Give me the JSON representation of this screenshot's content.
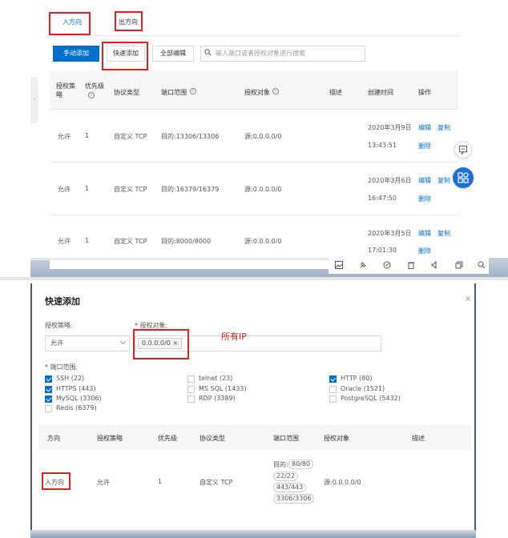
{
  "security_rules": {
    "tabs": [
      {
        "label": "入方向",
        "active": true
      },
      {
        "label": "出方向",
        "active": false
      }
    ],
    "toolbar": {
      "manual_add": "手动添加",
      "quick_add": "快速添加",
      "edit_all": "全部编辑",
      "search_placeholder": "输入端口或者授权对象进行搜索"
    },
    "columns": [
      "授权策略",
      "优先级",
      "协议类型",
      "端口范围",
      "授权对象",
      "描述",
      "创建时间",
      "操作"
    ],
    "rows": [
      {
        "policy": "允许",
        "priority": "1",
        "protocol": "自定义 TCP",
        "ports": "目的:13306/13306",
        "source": "源:0.0.0.0/0",
        "date": "2020年3月9日",
        "time": "13:43:51",
        "edit": "编辑",
        "copy": "复制",
        "delete": "删除"
      },
      {
        "policy": "允许",
        "priority": "1",
        "protocol": "自定义 TCP",
        "ports": "目的:16379/16379",
        "source": "源:0.0.0.0/0",
        "date": "2020年3月6日",
        "time": "16:47:50",
        "edit": "编辑",
        "copy": "复制",
        "delete": "删除"
      },
      {
        "policy": "允许",
        "priority": "1",
        "protocol": "自定义 TCP",
        "ports": "目的:8000/8000",
        "source": "源:0.0.0.0/0",
        "date": "2020年3月5日",
        "time": "17:01:30",
        "edit": "编辑",
        "copy": "复制",
        "delete": "删除"
      }
    ]
  },
  "quick_add_dialog": {
    "title": "快速添加",
    "close": "×",
    "policy_label": "授权策略:",
    "policy_value": "允许",
    "target_label": "授权对象:",
    "target_tag": "0.0.0.0/0",
    "tag_close": "×",
    "annotation": "所有IP",
    "port_label": "端口范围:",
    "ports": [
      {
        "label": "SSH (22)",
        "checked": true
      },
      {
        "label": "HTTPS (443)",
        "checked": true
      },
      {
        "label": "MySQL (3306)",
        "checked": true
      },
      {
        "label": "Redis (6379)",
        "checked": false
      },
      {
        "label": "telnet (23)",
        "checked": false
      },
      {
        "label": "MS SQL (1433)",
        "checked": false
      },
      {
        "label": "RDP (3389)",
        "checked": false
      },
      {
        "label": "HTTP (80)",
        "checked": true
      },
      {
        "label": "Oracle (1521)",
        "checked": false
      },
      {
        "label": "PostgreSQL (5432)",
        "checked": false
      }
    ],
    "preview_columns": [
      "方向",
      "授权策略",
      "优先级",
      "协议类型",
      "端口范围",
      "授权对象",
      "描述"
    ],
    "preview_row": {
      "direction": "入方向",
      "policy": "允许",
      "priority": "1",
      "protocol": "自定义 TCP",
      "port_prefix": "目的:",
      "ports": [
        "80/80",
        "22/22",
        "443/443",
        "3306/3306"
      ],
      "source": "源:0.0.0.0/0"
    }
  },
  "colors": {
    "primary": "#0070cc",
    "highlight": "#e02020",
    "float_button": "#1d6fd6"
  }
}
